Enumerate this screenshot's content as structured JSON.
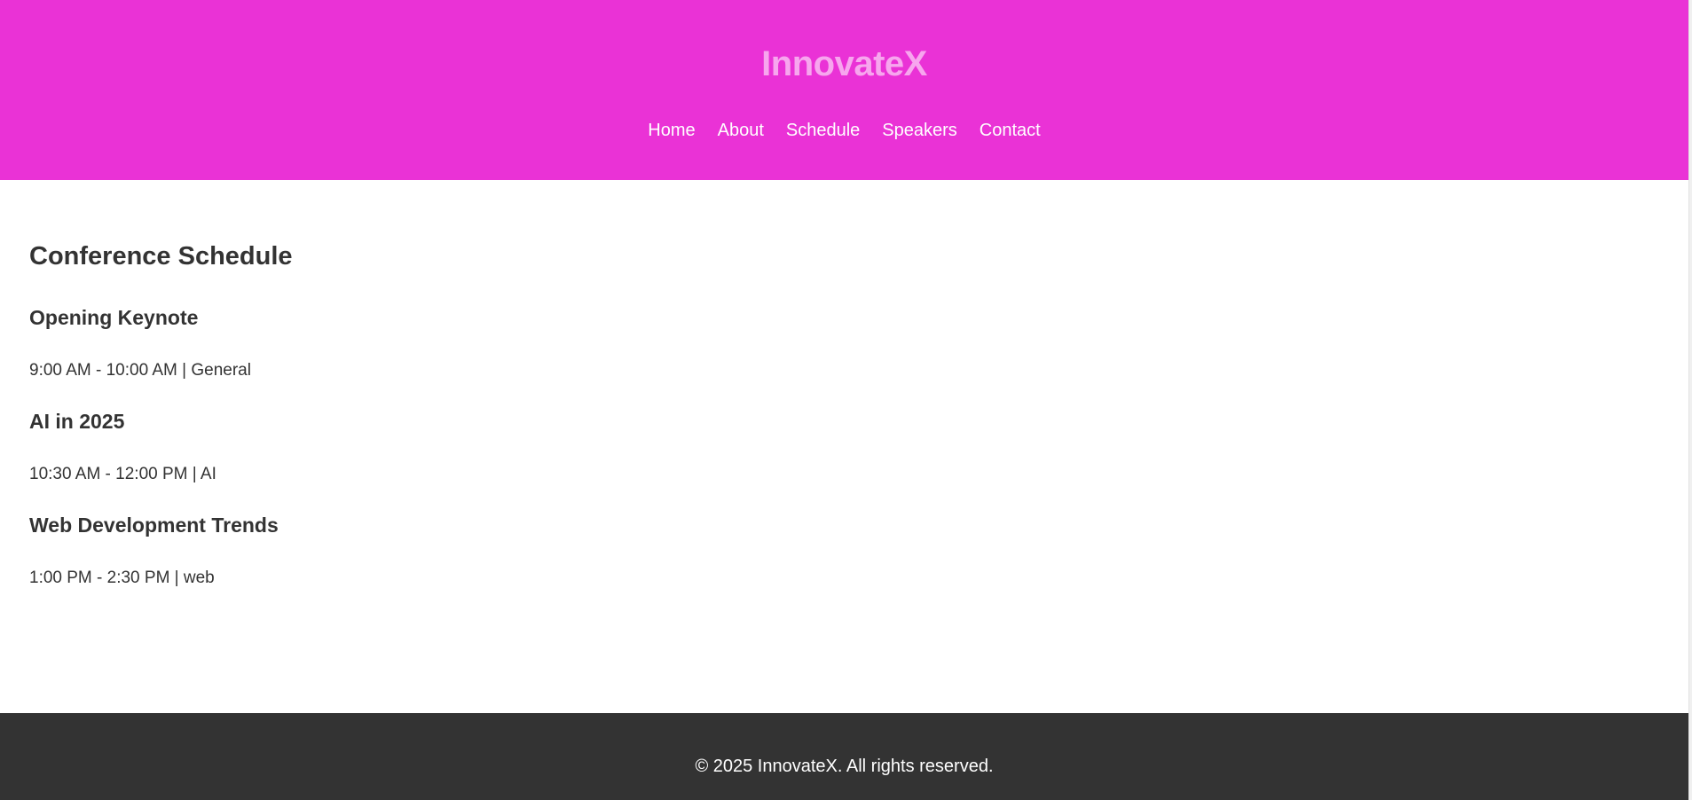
{
  "colors": {
    "header_bg": "#ea32d6",
    "title_color": "#f7a6ee",
    "nav_text": "#ffffff",
    "body_text": "#333333",
    "footer_bg": "#333333",
    "footer_text": "#ffffff"
  },
  "header": {
    "title": "InnovateX",
    "nav": [
      "Home",
      "About",
      "Schedule",
      "Speakers",
      "Contact"
    ]
  },
  "main": {
    "section_title": "Conference Schedule",
    "sessions": [
      {
        "name": "Opening Keynote",
        "time": "9:00 AM - 10:00 AM | General"
      },
      {
        "name": "AI in 2025",
        "time": "10:30 AM - 12:00 PM | AI"
      },
      {
        "name": "Web Development Trends",
        "time": "1:00 PM - 2:30 PM | web"
      }
    ]
  },
  "footer": {
    "copyright": "© 2025 InnovateX. All rights reserved."
  }
}
